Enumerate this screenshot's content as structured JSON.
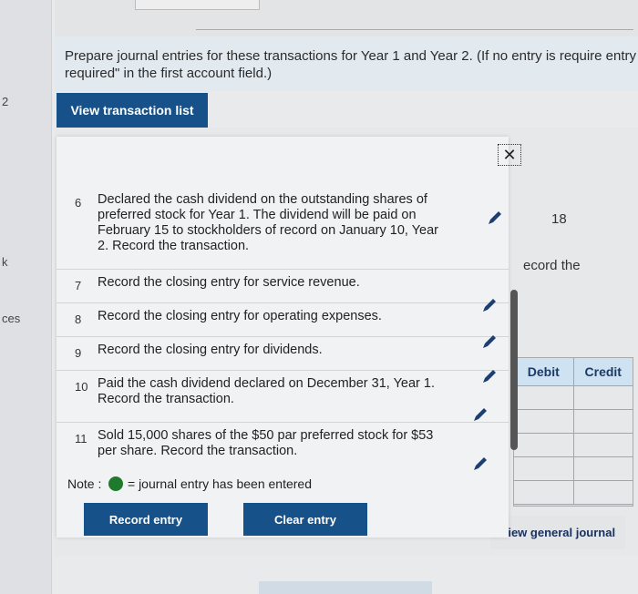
{
  "left_strip": {
    "labels": [
      "2",
      "k",
      "ces"
    ]
  },
  "instructions": "Prepare journal entries for these transactions for Year 1 and Year 2. (If no entry is require entry required\" in the first account field.)",
  "view_transaction_list_label": "View transaction list",
  "background": {
    "right_number": "18",
    "right_text": "ecord the",
    "journal_table": {
      "headers": [
        "Debit",
        "Credit"
      ]
    },
    "view_general_journal_label": "View general journal"
  },
  "transactions": [
    {
      "num": "6",
      "text": "Declared the cash dividend on the outstanding shares of preferred stock for Year 1. The dividend will be paid on February 15 to stockholders of record on January 10, Year 2. Record the transaction."
    },
    {
      "num": "7",
      "text": "Record the closing entry for service revenue."
    },
    {
      "num": "8",
      "text": "Record the closing entry for operating expenses."
    },
    {
      "num": "9",
      "text": "Record the closing entry for dividends."
    },
    {
      "num": "10",
      "text": "Paid the cash dividend declared on December 31, Year 1. Record the transaction."
    },
    {
      "num": "11",
      "text": "Sold 15,000 shares of the $50 par preferred stock for $53 per share. Record the transaction."
    }
  ],
  "note": {
    "label": "Note :",
    "text": "= journal entry has been entered"
  },
  "buttons": {
    "record_entry": "Record entry",
    "clear_entry": "Clear entry"
  },
  "icons": {
    "close": "close-icon",
    "edit": "pencil-icon",
    "status": "entered-dot-icon"
  },
  "colors": {
    "primary_button": "#17518a",
    "entered_dot": "#1f7a2e"
  }
}
